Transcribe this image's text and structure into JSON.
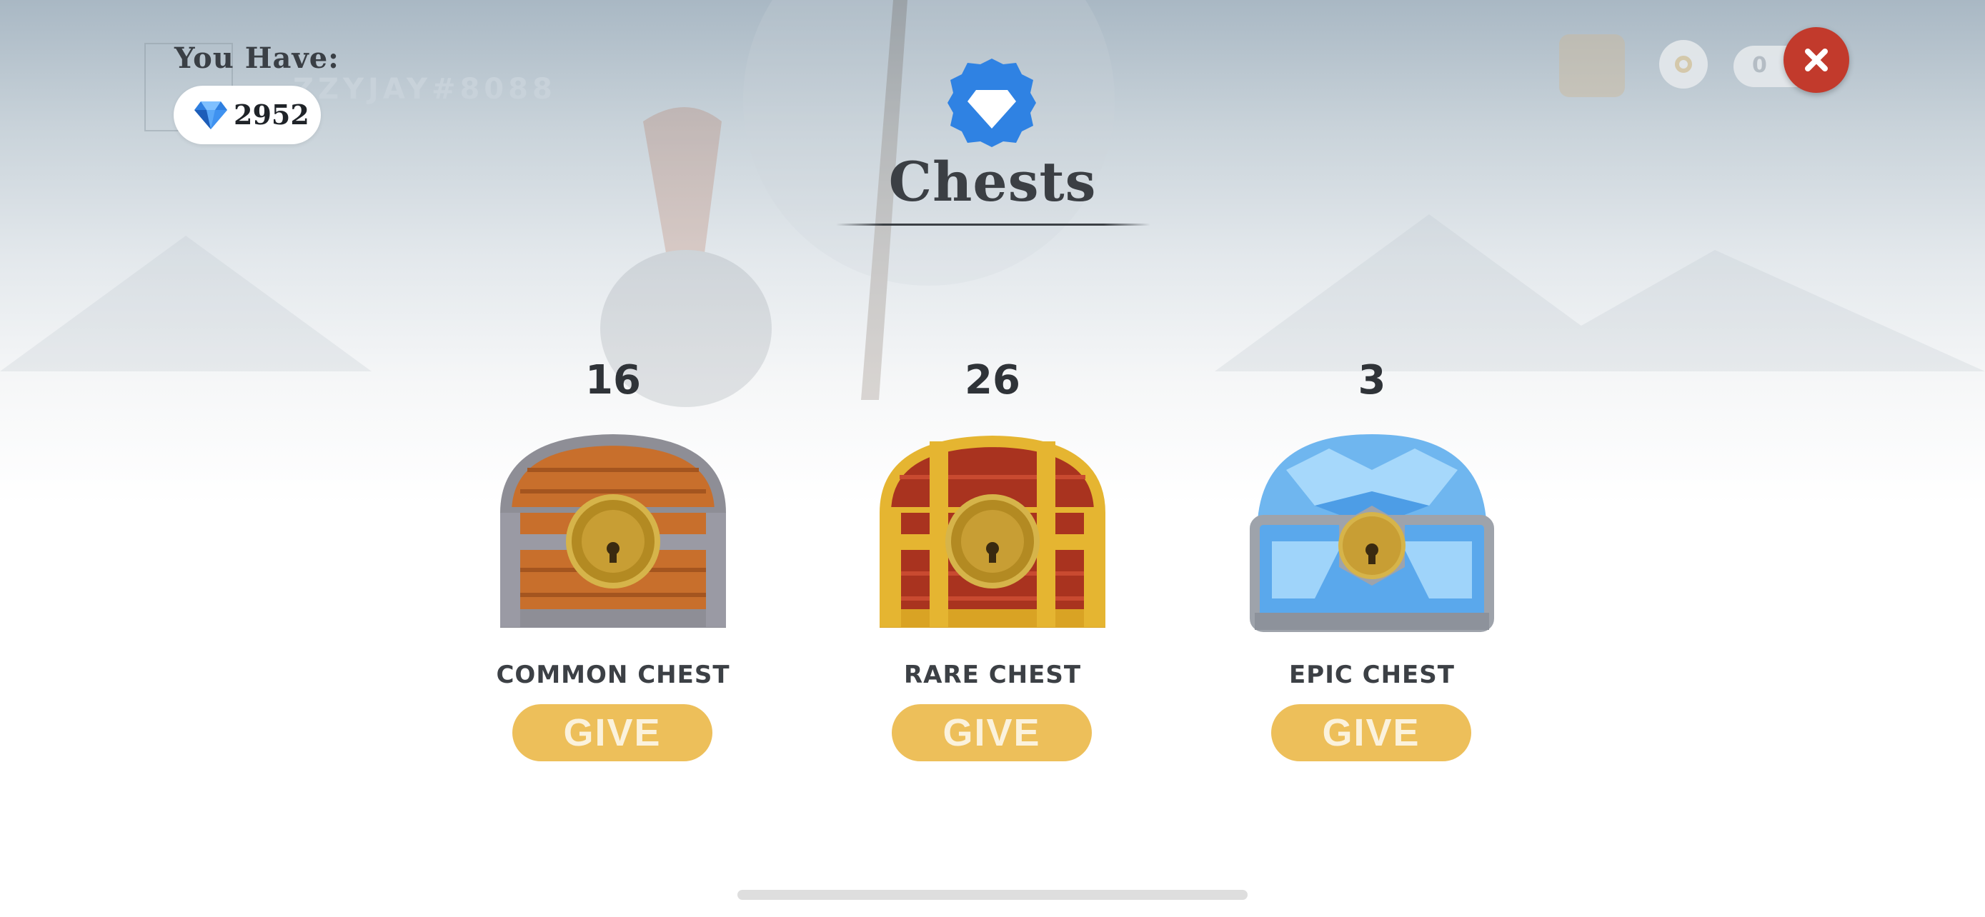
{
  "hud": {
    "you_have_label": "You Have:",
    "gems": "2952",
    "close_icon": "close-x-icon"
  },
  "background": {
    "username": "ZZYJAY#8088",
    "pill_value": "0"
  },
  "header": {
    "badge_icon": "gem-badge-icon",
    "title": "Chests"
  },
  "chests": [
    {
      "count": "16",
      "name": "COMMON CHEST",
      "button": "GIVE",
      "icon": "common-chest-icon"
    },
    {
      "count": "26",
      "name": "RARE CHEST",
      "button": "GIVE",
      "icon": "rare-chest-icon"
    },
    {
      "count": "3",
      "name": "EPIC CHEST",
      "button": "GIVE",
      "icon": "epic-chest-icon"
    }
  ],
  "colors": {
    "give_button": "#edbf5a",
    "close_button": "#c23a2c",
    "badge_blue": "#2f82e3",
    "text_dark": "#3b3f44"
  }
}
